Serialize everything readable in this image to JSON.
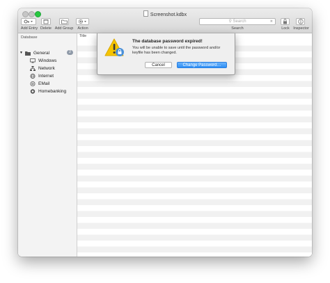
{
  "window": {
    "title": "Screenshot.kdbx"
  },
  "toolbar": {
    "add_entry": "Add Entry",
    "delete": "Delete",
    "add_group": "Add Group",
    "action": "Action",
    "search_placeholder": "Search",
    "search_label": "Search",
    "lock": "Lock",
    "inspector": "Inspector"
  },
  "sidebar": {
    "header": "Database",
    "group": {
      "label": "General",
      "count": "2"
    },
    "items": [
      {
        "label": "Windows",
        "icon": "windows-icon"
      },
      {
        "label": "Network",
        "icon": "network-icon"
      },
      {
        "label": "Internet",
        "icon": "globe-icon"
      },
      {
        "label": "EMail",
        "icon": "email-icon"
      },
      {
        "label": "Homebanking",
        "icon": "bank-icon"
      }
    ]
  },
  "table": {
    "columns": [
      "Title"
    ]
  },
  "dialog": {
    "title": "The database password expired!",
    "message": "You will be unable to save until the password and/or keyfile has been changed.",
    "cancel_label": "Cancel",
    "primary_label": "Change Password…",
    "icon": "warning-lock-icon"
  },
  "colors": {
    "accent": "#2d8ef6",
    "warning": "#f5c400"
  }
}
